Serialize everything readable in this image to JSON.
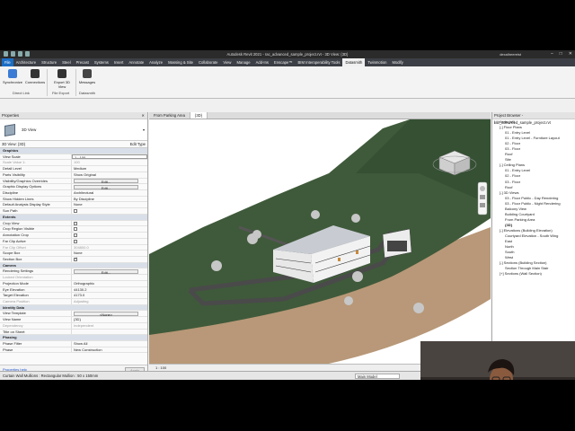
{
  "app": {
    "title": "Autodesk Revit 2021 - rac_advanced_sample_project.rvt - 3D View: {3D}",
    "user": "dexalheereist"
  },
  "ribbon": {
    "tabs": [
      "File",
      "Architecture",
      "Structure",
      "Steel",
      "Precast",
      "Systems",
      "Insert",
      "Annotate",
      "Analyze",
      "Massing & Site",
      "Collaborate",
      "View",
      "Manage",
      "Add-Ins",
      "Enscape™",
      "BIM Interoperability Tools",
      "Datasmith",
      "Twinmotion",
      "Modify"
    ],
    "active_tab": "Datasmith",
    "buttons": [
      {
        "label": "Synchronize",
        "icon": "sync-icon",
        "color": "#3a7bd5"
      },
      {
        "label": "Connections",
        "icon": "connections-icon",
        "color": "#333333"
      },
      {
        "label": "Export 3D View",
        "icon": "export-icon",
        "color": "#333333"
      },
      {
        "label": "Messages",
        "icon": "messages-icon",
        "color": "#444444"
      }
    ],
    "groups": [
      "Direct Link",
      "File Export",
      "Datasmith"
    ]
  },
  "properties": {
    "title": "Properties",
    "type_name": "3D View",
    "instance_filter": "3D View: {3D}",
    "edit_type": "Edit Type",
    "rows": [
      {
        "cat": "Graphics"
      },
      {
        "k": "View Scale",
        "v": "1 : 100",
        "kind": "input"
      },
      {
        "k": "Scale Value    1:",
        "v": "100",
        "kind": "ro"
      },
      {
        "k": "Detail Level",
        "v": "Medium"
      },
      {
        "k": "Parts Visibility",
        "v": "Show Original"
      },
      {
        "k": "Visibility/Graphics Overrides",
        "v": "Edit...",
        "kind": "btn"
      },
      {
        "k": "Graphic Display Options",
        "v": "Edit...",
        "kind": "btn"
      },
      {
        "k": "Discipline",
        "v": "Architectural"
      },
      {
        "k": "Show Hidden Lines",
        "v": "By Discipline"
      },
      {
        "k": "Default Analysis Display Style",
        "v": "None"
      },
      {
        "k": "Sun Path",
        "v": "",
        "kind": "chk"
      },
      {
        "cat": "Extents"
      },
      {
        "k": "Crop View",
        "v": "",
        "kind": "chk"
      },
      {
        "k": "Crop Region Visible",
        "v": "",
        "kind": "chk"
      },
      {
        "k": "Annotation Crop",
        "v": "",
        "kind": "chk"
      },
      {
        "k": "Far Clip Active",
        "v": "",
        "kind": "chk"
      },
      {
        "k": "Far Clip Offset",
        "v": "304800.0",
        "kind": "ro"
      },
      {
        "k": "Scope Box",
        "v": "None"
      },
      {
        "k": "Section Box",
        "v": "",
        "kind": "chkon"
      },
      {
        "cat": "Camera"
      },
      {
        "k": "Rendering Settings",
        "v": "Edit...",
        "kind": "btn"
      },
      {
        "k": "Locked Orientation",
        "v": "",
        "kind": "ro"
      },
      {
        "k": "Projection Mode",
        "v": "Orthographic"
      },
      {
        "k": "Eye Elevation",
        "v": "44130.2"
      },
      {
        "k": "Target Elevation",
        "v": "4173.0"
      },
      {
        "k": "Camera Position",
        "v": "Adjusting",
        "kind": "ro"
      },
      {
        "cat": "Identity Data"
      },
      {
        "k": "View Template",
        "v": "<None>",
        "kind": "btn"
      },
      {
        "k": "View Name",
        "v": "{3D}"
      },
      {
        "k": "Dependency",
        "v": "Independent",
        "kind": "ro"
      },
      {
        "k": "Title on Sheet",
        "v": ""
      },
      {
        "cat": "Phasing"
      },
      {
        "k": "Phase Filter",
        "v": "Show All"
      },
      {
        "k": "Phase",
        "v": "New Construction"
      }
    ],
    "help_link": "Properties help",
    "apply": "Apply"
  },
  "view_tabs": [
    "From Parking Area",
    "{3D}"
  ],
  "view_bar": {
    "scale": "1 : 100"
  },
  "browser": {
    "title": "Project Browser - rac_advanced_sample_project.rvt",
    "items": [
      {
        "t": "[-] Views (all)",
        "lvl": 0
      },
      {
        "t": "[-] Floor Plans",
        "lvl": 1
      },
      {
        "t": "01 - Entry Level",
        "lvl": 2
      },
      {
        "t": "01 - Entry Level - Furniture Layout",
        "lvl": 2
      },
      {
        "t": "02 - Floor",
        "lvl": 2
      },
      {
        "t": "03 - Floor",
        "lvl": 2
      },
      {
        "t": "Roof",
        "lvl": 2
      },
      {
        "t": "Site",
        "lvl": 2
      },
      {
        "t": "[-] Ceiling Plans",
        "lvl": 1
      },
      {
        "t": "01 - Entry Level",
        "lvl": 2
      },
      {
        "t": "02 - Floor",
        "lvl": 2
      },
      {
        "t": "03 - Floor",
        "lvl": 2
      },
      {
        "t": "Roof",
        "lvl": 2
      },
      {
        "t": "[-] 3D Views",
        "lvl": 1
      },
      {
        "t": "03 - Floor Public - Day Rendering",
        "lvl": 2
      },
      {
        "t": "03 - Floor Public - Night Rendering",
        "lvl": 2
      },
      {
        "t": "Balcony View",
        "lvl": 2
      },
      {
        "t": "Building Courtyard",
        "lvl": 2
      },
      {
        "t": "From Parking Area",
        "lvl": 2
      },
      {
        "t": "{3D}",
        "lvl": 2,
        "bold": true
      },
      {
        "t": "[-] Elevations (Building Elevation)",
        "lvl": 1
      },
      {
        "t": "Courtyard Elevation - South Wing",
        "lvl": 2
      },
      {
        "t": "East",
        "lvl": 2
      },
      {
        "t": "North",
        "lvl": 2
      },
      {
        "t": "South",
        "lvl": 2
      },
      {
        "t": "West",
        "lvl": 2
      },
      {
        "t": "[-] Sections (Building Section)",
        "lvl": 1
      },
      {
        "t": "Section Through Main Stair",
        "lvl": 2
      },
      {
        "t": "[+] Sections (Wall Section)",
        "lvl": 1
      }
    ]
  },
  "status": {
    "text": "Curtain Wall Mullions : Rectangular Mullion : 50 x 150mm",
    "model": "Main Model"
  },
  "colors": {
    "terrain": "#3f5a3a",
    "ground_edge": "#b89878",
    "road": "#4a4a4a"
  }
}
